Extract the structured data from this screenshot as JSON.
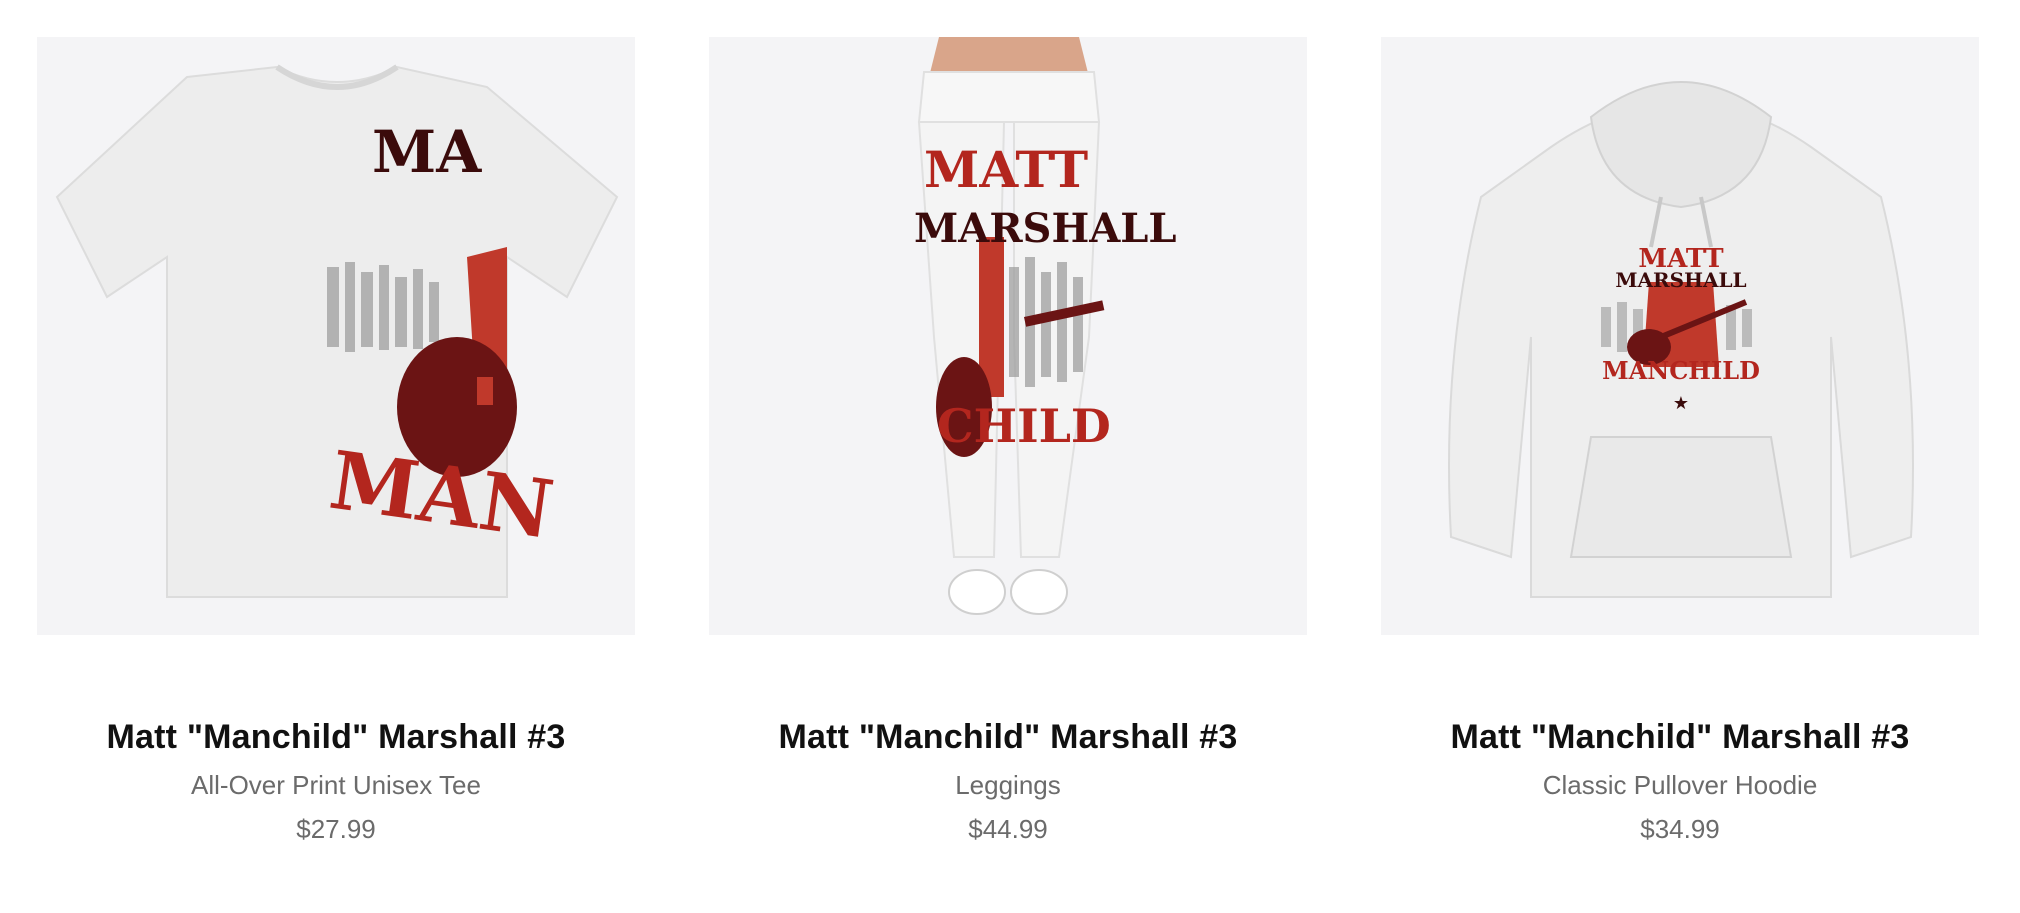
{
  "products": [
    {
      "title": "Matt \"Manchild\" Marshall #3",
      "type": "All-Over Print Unisex Tee",
      "price": "$27.99",
      "image_icon": "tshirt-icon",
      "print_text_top": "MA",
      "print_text_bottom": "MAN"
    },
    {
      "title": "Matt \"Manchild\" Marshall #3",
      "type": "Leggings",
      "price": "$44.99",
      "image_icon": "leggings-icon",
      "print_text_top": "MATT",
      "print_text_mid": "MARSHALL",
      "print_text_bottom": "CHILD"
    },
    {
      "title": "Matt \"Manchild\" Marshall #3",
      "type": "Classic Pullover Hoodie",
      "price": "$34.99",
      "image_icon": "hoodie-icon",
      "print_text_top": "MATT",
      "print_text_mid": "MARSHALL",
      "print_text_bottom": "MANCHILD"
    }
  ],
  "colors": {
    "thumb_bg": "#f4f4f6",
    "garment": "#eeeeee",
    "print_red": "#b3261e",
    "print_dark_red": "#5e1212",
    "title": "#111111",
    "muted": "#6b6b6b"
  }
}
